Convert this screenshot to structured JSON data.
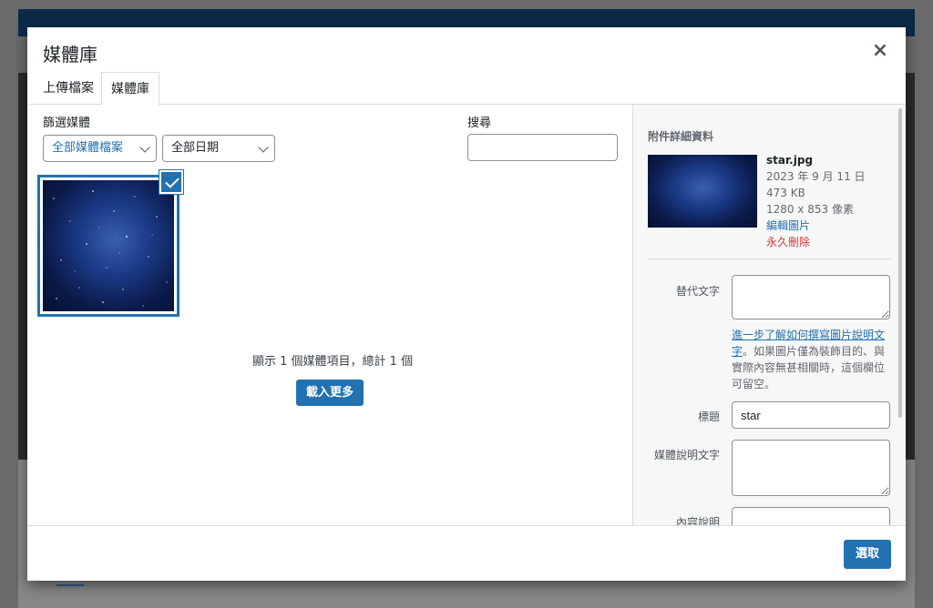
{
  "modal": {
    "title": "媒體庫",
    "close_symbol": "×"
  },
  "tabs": [
    {
      "label": "上傳檔案"
    },
    {
      "label": "媒體庫",
      "active": true
    }
  ],
  "filters": {
    "label": "篩選媒體",
    "type_selected": "全部媒體檔案",
    "date_selected": "全部日期"
  },
  "search": {
    "label": "搜尋",
    "value": ""
  },
  "grid": {
    "items": [
      {
        "name": "star.jpg",
        "selected": true
      }
    ],
    "count_text": "顯示 1 個媒體項目，總計 1 個",
    "load_more_label": "載入更多"
  },
  "details": {
    "heading": "附件詳細資料",
    "filename": "star.jpg",
    "date": "2023 年 9 月 11 日",
    "filesize": "473 KB",
    "dimensions": "1280 x 853 像素",
    "edit_link": "編輯圖片",
    "delete_link": "永久刪除",
    "alt_label": "替代文字",
    "alt_value": "",
    "alt_help_link": "進一步了解如何撰寫圖片說明文字",
    "alt_help_text": "。如果圖片僅為裝飾目的、與實際內容無甚相關時，這個欄位可留空。",
    "title_label": "標題",
    "title_value": "star",
    "caption_label": "媒體說明文字",
    "caption_value": "",
    "description_label": "內容說明"
  },
  "footer": {
    "select_label": "選取"
  },
  "colors": {
    "primary": "#2271b1",
    "danger": "#d63638",
    "sidebar_bg": "#f6f7f7"
  }
}
